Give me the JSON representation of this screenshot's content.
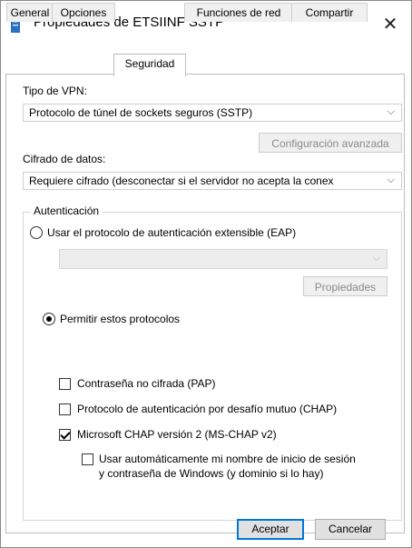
{
  "window": {
    "title": "Propiedades de ETSIINF SSTP",
    "close_glyph": "✕"
  },
  "tabs": [
    {
      "label": "General",
      "active": false
    },
    {
      "label": "Opciones",
      "active": false
    },
    {
      "label": "Seguridad",
      "active": true
    },
    {
      "label": "Funciones de red",
      "active": false
    },
    {
      "label": "Compartir",
      "active": false
    }
  ],
  "vpn": {
    "type_label": "Tipo de VPN:",
    "type_value": "Protocolo de túnel de sockets seguros (SSTP)",
    "advanced_button": "Configuración avanzada"
  },
  "encryption": {
    "label": "Cifrado de datos:",
    "value": "Requiere cifrado (desconectar si el servidor no acepta la conex"
  },
  "auth": {
    "title": "Autenticación",
    "eap_label": "Usar el protocolo de autenticación extensible (EAP)",
    "eap_selected": false,
    "eap_combo_value": "",
    "properties_button": "Propiedades",
    "allow_label": "Permitir estos protocolos",
    "allow_selected": true,
    "pap_label": "Contraseña no cifrada (PAP)",
    "pap_checked": false,
    "chap_label": "Protocolo de autenticación por desafío mutuo (CHAP)",
    "chap_checked": false,
    "mschap_label": "Microsoft CHAP versión 2 (MS-CHAP v2)",
    "mschap_checked": true,
    "autologon_line1": "Usar automáticamente mi nombre de inicio de sesión",
    "autologon_line2": "y contraseña de Windows (y dominio si lo hay)",
    "autologon_checked": false
  },
  "footer": {
    "ok": "Aceptar",
    "cancel": "Cancelar"
  },
  "colors": {
    "accent": "#0078d7",
    "icon": "#2b6fbf"
  },
  "icons": {
    "window": "vpn-connection-icon",
    "dropdown": "chevron-down-icon"
  }
}
